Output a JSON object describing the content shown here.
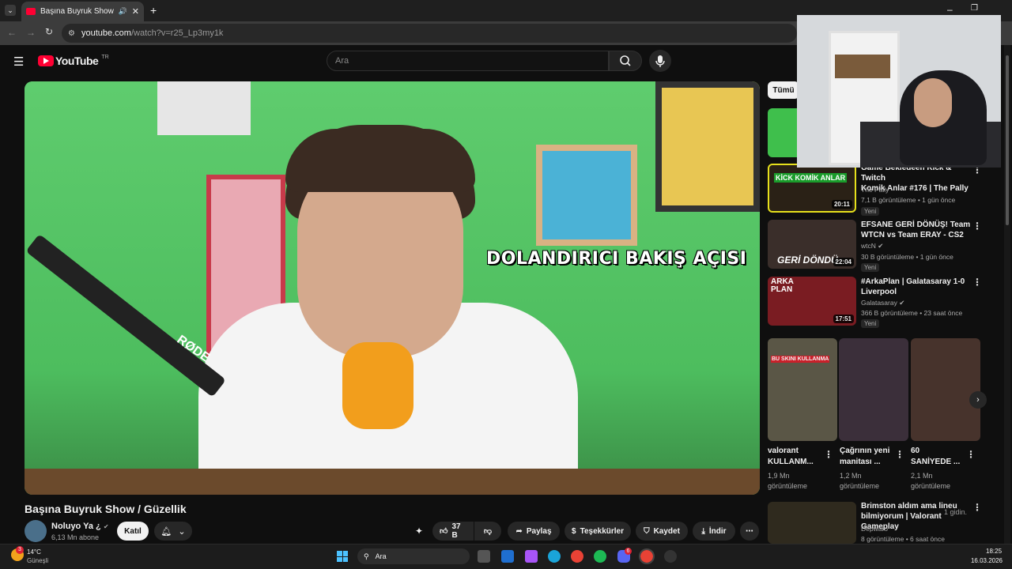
{
  "browser": {
    "tab_title": "Başına Buyruk Show / Güze",
    "url_host": "youtube.com",
    "url_path": "/watch?v=r25_Lp3my1k"
  },
  "youtube": {
    "logo_text": "YouTube",
    "logo_country": "TR",
    "search_placeholder": "Ara"
  },
  "video": {
    "overlay_text": "DOLANDIRICI BAKIŞ AÇISI",
    "mic_brand": "RØDE",
    "title": "Başına Buyruk Show / Güzellik",
    "channel_name": "Noluyo Ya ¿",
    "channel_subs": "6,13 Mn abone",
    "join_label": "Katıl",
    "likes": "37 B",
    "share_label": "Paylaş",
    "thanks_label": "Teşekkürler",
    "save_label": "Kaydet",
    "download_label": "İndir"
  },
  "rail": {
    "chip_all": "Tümü",
    "items": [
      {
        "title_line1": "Game Bekledeen Kick & Twitch",
        "title_line2": "Komik Anlar #176 | The Pally",
        "channel": "The Pally",
        "meta": "7,1 B görüntüleme • 1 gün önce",
        "badge": "Yeni",
        "duration": "20:11",
        "thumb_text": "KİCK KOMİK ANLAR"
      },
      {
        "title_line1": "EFSANE GERİ DÖNÜŞ! Team",
        "title_line2": "WTCN vs Team ERAY - CS2",
        "channel": "wtcN",
        "meta": "30 B görüntüleme • 1 gün önce",
        "badge": "Yeni",
        "duration": "22:04",
        "thumb_text": "GERİ DÖNDÜ"
      },
      {
        "title_line1": "#ArkaPlan | Galatasaray 1-0",
        "title_line2": "Liverpool",
        "channel": "Galatasaray",
        "meta": "366 B görüntüleme • 23 saat önce",
        "badge": "Yeni",
        "duration": "17:51",
        "thumb_text": "ARKA PLAN"
      }
    ],
    "shorts": [
      {
        "title_line1": "valorant",
        "title_line2": "KULLANM...",
        "views": "1,9 Mn",
        "views_label": "görüntüleme",
        "thumb_text": "BU SKINI KULLANMA"
      },
      {
        "title_line1": "Çağrının yeni",
        "title_line2": "manitası ...",
        "views": "1,2 Mn",
        "views_label": "görüntüleme",
        "thumb_text": ""
      },
      {
        "title_line1": "60",
        "title_line2": "SANİYEDE ...",
        "views": "2,1 Mn",
        "views_label": "görüntüleme",
        "thumb_text": ""
      }
    ],
    "last_item": {
      "title_line1": "Brimston aldım ama lineu",
      "title_line2": "bilmiyorum | Valorant Gameplay",
      "channel": "Depwaro",
      "meta": "8 görüntüleme • 6 saat önce",
      "hint": "1 gidin."
    }
  },
  "taskbar": {
    "weather_temp": "14°C",
    "weather_label": "Güneşli",
    "weather_badge": "3",
    "search_label": "Ara",
    "time": "18:25",
    "date": "16.03.2026",
    "discord_badge": "6"
  }
}
